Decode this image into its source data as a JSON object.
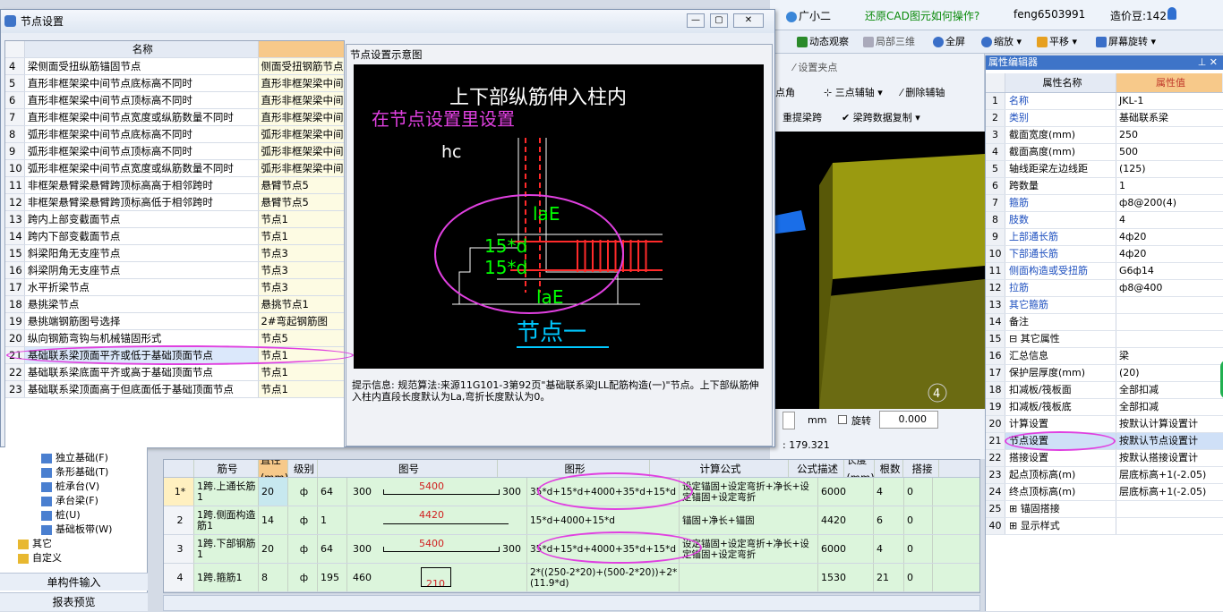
{
  "topbar": {
    "guang_label": "广小二",
    "help_link": "还原CAD图元如何操作?",
    "user": "feng6503991",
    "points": "造价豆:142"
  },
  "toolbar2": {
    "items": [
      "动态观察",
      "局部三维",
      "全屏",
      "缩放",
      "平移",
      "屏幕旋转"
    ]
  },
  "cad_tools": {
    "row1": [
      "设置夹点"
    ],
    "row2": [
      "点角",
      "三点辅轴",
      "删除辅轴"
    ],
    "row3": [
      "重提梁跨",
      "梁跨数据复制"
    ]
  },
  "view3d": {
    "marker": "4"
  },
  "coord_inputs": {
    "unit": "mm",
    "rotate_label": "旋转",
    "rotate_value": "0.000",
    "coord_text": "179.321"
  },
  "props": {
    "title": "属性编辑器",
    "headers": {
      "name": "属性名称",
      "value": "属性值"
    },
    "rows": [
      {
        "n": "1",
        "name": "名称",
        "value": "JKL-1",
        "blue": true
      },
      {
        "n": "2",
        "name": "类别",
        "value": "基础联系梁",
        "blue": true
      },
      {
        "n": "3",
        "name": "截面宽度(mm)",
        "value": "250",
        "blue": false
      },
      {
        "n": "4",
        "name": "截面高度(mm)",
        "value": "500",
        "blue": false
      },
      {
        "n": "5",
        "name": "轴线距梁左边线距",
        "value": "(125)",
        "blue": false
      },
      {
        "n": "6",
        "name": "跨数量",
        "value": "1",
        "blue": false
      },
      {
        "n": "7",
        "name": "箍筋",
        "value": "ф8@200(4)",
        "blue": true
      },
      {
        "n": "8",
        "name": "肢数",
        "value": "4",
        "blue": true
      },
      {
        "n": "9",
        "name": "上部通长筋",
        "value": "4ф20",
        "blue": true
      },
      {
        "n": "10",
        "name": "下部通长筋",
        "value": "4ф20",
        "blue": true
      },
      {
        "n": "11",
        "name": "侧面构造或受扭筋",
        "value": "G6ф14",
        "blue": true
      },
      {
        "n": "12",
        "name": "拉筋",
        "value": "ф8@400",
        "blue": true
      },
      {
        "n": "13",
        "name": "其它箍筋",
        "value": "",
        "blue": true
      },
      {
        "n": "14",
        "name": "备注",
        "value": "",
        "blue": false
      },
      {
        "n": "15",
        "name": "⊟ 其它属性",
        "value": "",
        "blue": false
      },
      {
        "n": "16",
        "name": "  汇总信息",
        "value": "梁",
        "blue": false
      },
      {
        "n": "17",
        "name": "  保护层厚度(mm)",
        "value": "(20)",
        "blue": false
      },
      {
        "n": "18",
        "name": "  扣减板/筏板面",
        "value": "全部扣减",
        "blue": false
      },
      {
        "n": "19",
        "name": "  扣减板/筏板底",
        "value": "全部扣减",
        "blue": false
      },
      {
        "n": "20",
        "name": "  计算设置",
        "value": "按默认计算设置计",
        "blue": false
      },
      {
        "n": "21",
        "name": "  节点设置",
        "value": "按默认节点设置计",
        "blue": false
      },
      {
        "n": "22",
        "name": "  搭接设置",
        "value": "按默认搭接设置计",
        "blue": false
      },
      {
        "n": "23",
        "name": "  起点顶标高(m)",
        "value": "层底标高+1(-2.05)",
        "blue": false
      },
      {
        "n": "24",
        "name": "  终点顶标高(m)",
        "value": "层底标高+1(-2.05)",
        "blue": false
      },
      {
        "n": "25",
        "name": "⊞ 锚固搭接",
        "value": "",
        "blue": false
      },
      {
        "n": "40",
        "name": "⊞ 显示样式",
        "value": "",
        "blue": false
      }
    ]
  },
  "dialog": {
    "title": "节点设置",
    "header_name": "名称",
    "rows": [
      {
        "n": "4",
        "name": "梁侧面受扭纵筋锚固节点",
        "value": "侧面受扭钢筋节点"
      },
      {
        "n": "5",
        "name": "直形非框架梁中间节点底标高不同时",
        "value": "直形非框架梁中间"
      },
      {
        "n": "6",
        "name": "直形非框架梁中间节点顶标高不同时",
        "value": "直形非框架梁中间"
      },
      {
        "n": "7",
        "name": "直形非框架梁中间节点宽度或纵筋数量不同时",
        "value": "直形非框架梁中间"
      },
      {
        "n": "8",
        "name": "弧形非框架梁中间节点底标高不同时",
        "value": "弧形非框架梁中间"
      },
      {
        "n": "9",
        "name": "弧形非框架梁中间节点顶标高不同时",
        "value": "弧形非框架梁中间"
      },
      {
        "n": "10",
        "name": "弧形非框架梁中间节点宽度或纵筋数量不同时",
        "value": "弧形非框架梁中间"
      },
      {
        "n": "11",
        "name": "非框架悬臂梁悬臂跨顶标高高于相邻跨时",
        "value": "悬臂节点5"
      },
      {
        "n": "12",
        "name": "非框架悬臂梁悬臂跨顶标高低于相邻跨时",
        "value": "悬臂节点5"
      },
      {
        "n": "13",
        "name": "跨内上部变截面节点",
        "value": "节点1"
      },
      {
        "n": "14",
        "name": "跨内下部变截面节点",
        "value": "节点1"
      },
      {
        "n": "15",
        "name": "斜梁阳角无支座节点",
        "value": "节点3"
      },
      {
        "n": "16",
        "name": "斜梁阴角无支座节点",
        "value": "节点3"
      },
      {
        "n": "17",
        "name": "水平折梁节点",
        "value": "节点3"
      },
      {
        "n": "18",
        "name": "悬挑梁节点",
        "value": "悬挑节点1"
      },
      {
        "n": "19",
        "name": "悬挑端钢筋图号选择",
        "value": "2#弯起钢筋图"
      },
      {
        "n": "20",
        "name": "纵向钢筋弯钩与机械锚固形式",
        "value": "节点5"
      },
      {
        "n": "21",
        "name": "基础联系梁顶面平齐或低于基础顶面节点",
        "value": "节点1"
      },
      {
        "n": "22",
        "name": "基础联系梁底面平齐或高于基础顶面节点",
        "value": "节点1"
      },
      {
        "n": "23",
        "name": "基础联系梁顶面高于但底面低于基础顶面节点",
        "value": "节点1"
      }
    ],
    "panel_title": "节点设置示意图",
    "diagram": {
      "title": "上下部纵筋伸入柱内",
      "annotation": "在节点设置里设置",
      "hc": "hc",
      "lae_top": "laE",
      "d1": "15*d",
      "d2": "15*d",
      "lae_bottom": "laE",
      "node_label": "节点一"
    },
    "hint": "提示信息:  规范算法:来源11G101-3第92页\"基础联系梁JLL配筋构造(一)\"节点。上下部纵筋伸入柱内直段长度默认为La,弯折长度默认为0。"
  },
  "leftnav": {
    "items": [
      "独立基础(F)",
      "条形基础(T)",
      "桩承台(V)",
      "承台梁(F)",
      "桩(U)",
      "基础板带(W)",
      "其它",
      "自定义"
    ],
    "btn1": "单构件输入",
    "btn2": "报表预览"
  },
  "rebar": {
    "headers": [
      "筋号",
      "直径(mm)",
      "级别",
      "图号",
      "图形",
      "计算公式",
      "公式描述",
      "长度(mm)",
      "根数",
      "搭接"
    ],
    "rows": [
      {
        "idx": "1*",
        "name": "1跨.上通长筋1",
        "dia": "20",
        "grade": "ф",
        "fig": "64",
        "shape_l": "300",
        "shape_mid": "5400",
        "shape_r": "300",
        "formula": "35*d+15*d+4000+35*d+15*d",
        "desc": "设定锚固+设定弯折+净长+设定锚固+设定弯折",
        "len": "6000",
        "count": "4",
        "lap": "0"
      },
      {
        "idx": "2",
        "name": "1跨.侧面构造筋1",
        "dia": "14",
        "grade": "ф",
        "fig": "1",
        "shape_l": "",
        "shape_mid": "4420",
        "shape_r": "",
        "formula": "15*d+4000+15*d",
        "desc": "锚固+净长+锚固",
        "len": "4420",
        "count": "6",
        "lap": "0"
      },
      {
        "idx": "3",
        "name": "1跨.下部钢筋1",
        "dia": "20",
        "grade": "ф",
        "fig": "64",
        "shape_l": "300",
        "shape_mid": "5400",
        "shape_r": "300",
        "formula": "35*d+15*d+4000+35*d+15*d",
        "desc": "设定锚固+设定弯折+净长+设定锚固+设定弯折",
        "len": "6000",
        "count": "4",
        "lap": "0"
      },
      {
        "idx": "4",
        "name": "1跨.箍筋1",
        "dia": "8",
        "grade": "ф",
        "fig": "195",
        "shape_l": "460",
        "shape_mid": "210",
        "shape_r": "",
        "formula": "2*((250-2*20)+(500-2*20))+2*(11.9*d)",
        "desc": "",
        "len": "1530",
        "count": "21",
        "lap": "0"
      }
    ]
  },
  "colors": {
    "accent": "#e040e0",
    "title_blue": "#3e74c8",
    "cad_green": "#00ff00",
    "cad_red": "#ff2a2a",
    "cad_cyan": "#00c8ff"
  }
}
